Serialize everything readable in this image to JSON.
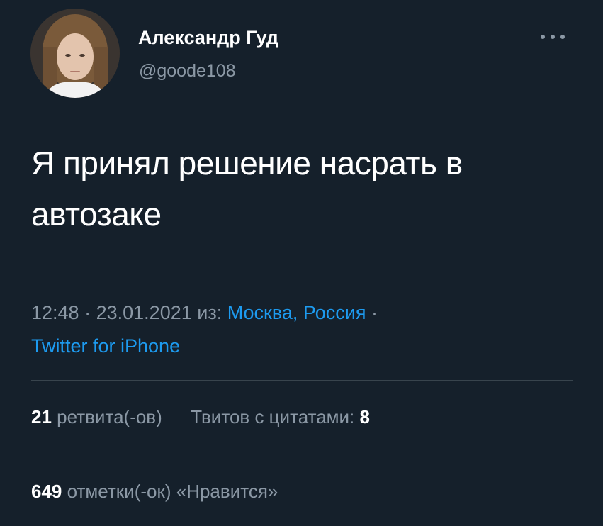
{
  "author": {
    "name": "Александр Гуд",
    "handle": "@goode108"
  },
  "tweet": {
    "text_line1": "Я принял решение насрать в",
    "text_line2": "автозаке"
  },
  "meta": {
    "time": "12:48",
    "date": "23.01.2021",
    "from_label": "из:",
    "location": "Москва, Россия",
    "separator": "·",
    "source": "Twitter for iPhone"
  },
  "stats": {
    "retweets_count": "21",
    "retweets_label": "ретвита(-ов)",
    "quotes_label": "Твитов с цитатами:",
    "quotes_count": "8",
    "likes_count": "649",
    "likes_label": "отметки(-ок) «Нравится»"
  },
  "colors": {
    "background": "#15202b",
    "text_primary": "#ffffff",
    "text_secondary": "#8b98a5",
    "link": "#1d9bf0",
    "divider": "#38444d"
  }
}
